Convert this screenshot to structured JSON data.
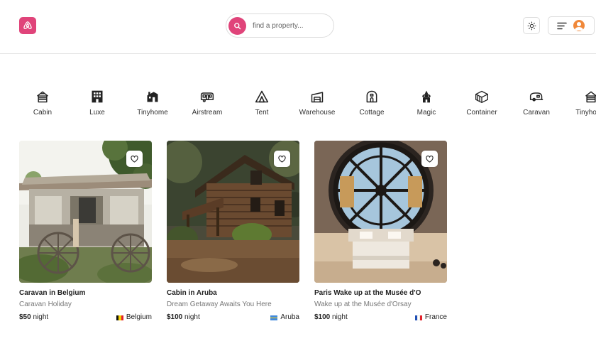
{
  "header": {
    "search_placeholder": "find a property...",
    "logo_icon": "airbnb-logo-icon",
    "theme_icon": "sun-icon",
    "menu_icon": "menu-icon",
    "avatar_icon": "user-avatar-icon",
    "brand_color": "#e0447a"
  },
  "categories": [
    {
      "label": "Cabin",
      "icon": "cabin-icon"
    },
    {
      "label": "Luxe",
      "icon": "building-icon"
    },
    {
      "label": "Tinyhome",
      "icon": "tinyhome-icon"
    },
    {
      "label": "Airstream",
      "icon": "airstream-icon"
    },
    {
      "label": "Tent",
      "icon": "tent-icon"
    },
    {
      "label": "Warehouse",
      "icon": "warehouse-icon"
    },
    {
      "label": "Cottage",
      "icon": "cottage-icon"
    },
    {
      "label": "Magic",
      "icon": "magic-icon"
    },
    {
      "label": "Container",
      "icon": "container-icon"
    },
    {
      "label": "Caravan",
      "icon": "caravan-icon"
    },
    {
      "label": "Tinyhome",
      "icon": "tinyhome-icon"
    }
  ],
  "listings": [
    {
      "title": "Caravan in Belgium",
      "subtitle": "Caravan Holiday",
      "price": "$50",
      "price_unit": "night",
      "country": "Belgium",
      "flag_icon": "belgium-flag-icon"
    },
    {
      "title": "Cabin in Aruba",
      "subtitle": "Dream Getaway Awaits You Here",
      "price": "$100",
      "price_unit": "night",
      "country": "Aruba",
      "flag_icon": "aruba-flag-icon"
    },
    {
      "title": "Paris Wake up at the Musée d'O",
      "subtitle": "Wake up at the Musée d'Orsay",
      "price": "$100",
      "price_unit": "night",
      "country": "France",
      "flag_icon": "france-flag-icon"
    }
  ]
}
